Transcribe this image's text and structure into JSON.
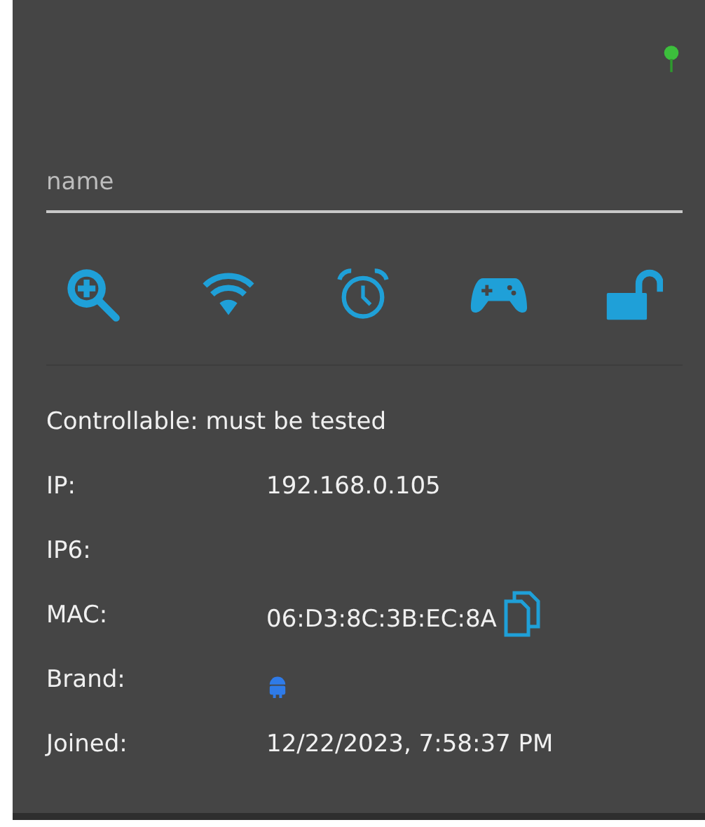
{
  "status": {
    "online": true
  },
  "name_field": {
    "placeholder": "name"
  },
  "actions": [
    {
      "kind": "zoom"
    },
    {
      "kind": "wifi"
    },
    {
      "kind": "alarm"
    },
    {
      "kind": "gamepad"
    },
    {
      "kind": "lock",
      "locked": false
    }
  ],
  "controllable": {
    "label": "Controllable:",
    "value": "must be tested"
  },
  "info": [
    {
      "kind": "text",
      "label": "IP:",
      "value": "192.168.0.105"
    },
    {
      "kind": "text",
      "label": "IP6:"
    },
    {
      "kind": "copy",
      "label": "MAC:",
      "value": "06:D3:8C:3B:EC:8A"
    },
    {
      "kind": "brand",
      "label": "Brand:"
    },
    {
      "kind": "text",
      "label": "Joined:",
      "value": "12/22/2023, 7:58:37 PM"
    }
  ]
}
